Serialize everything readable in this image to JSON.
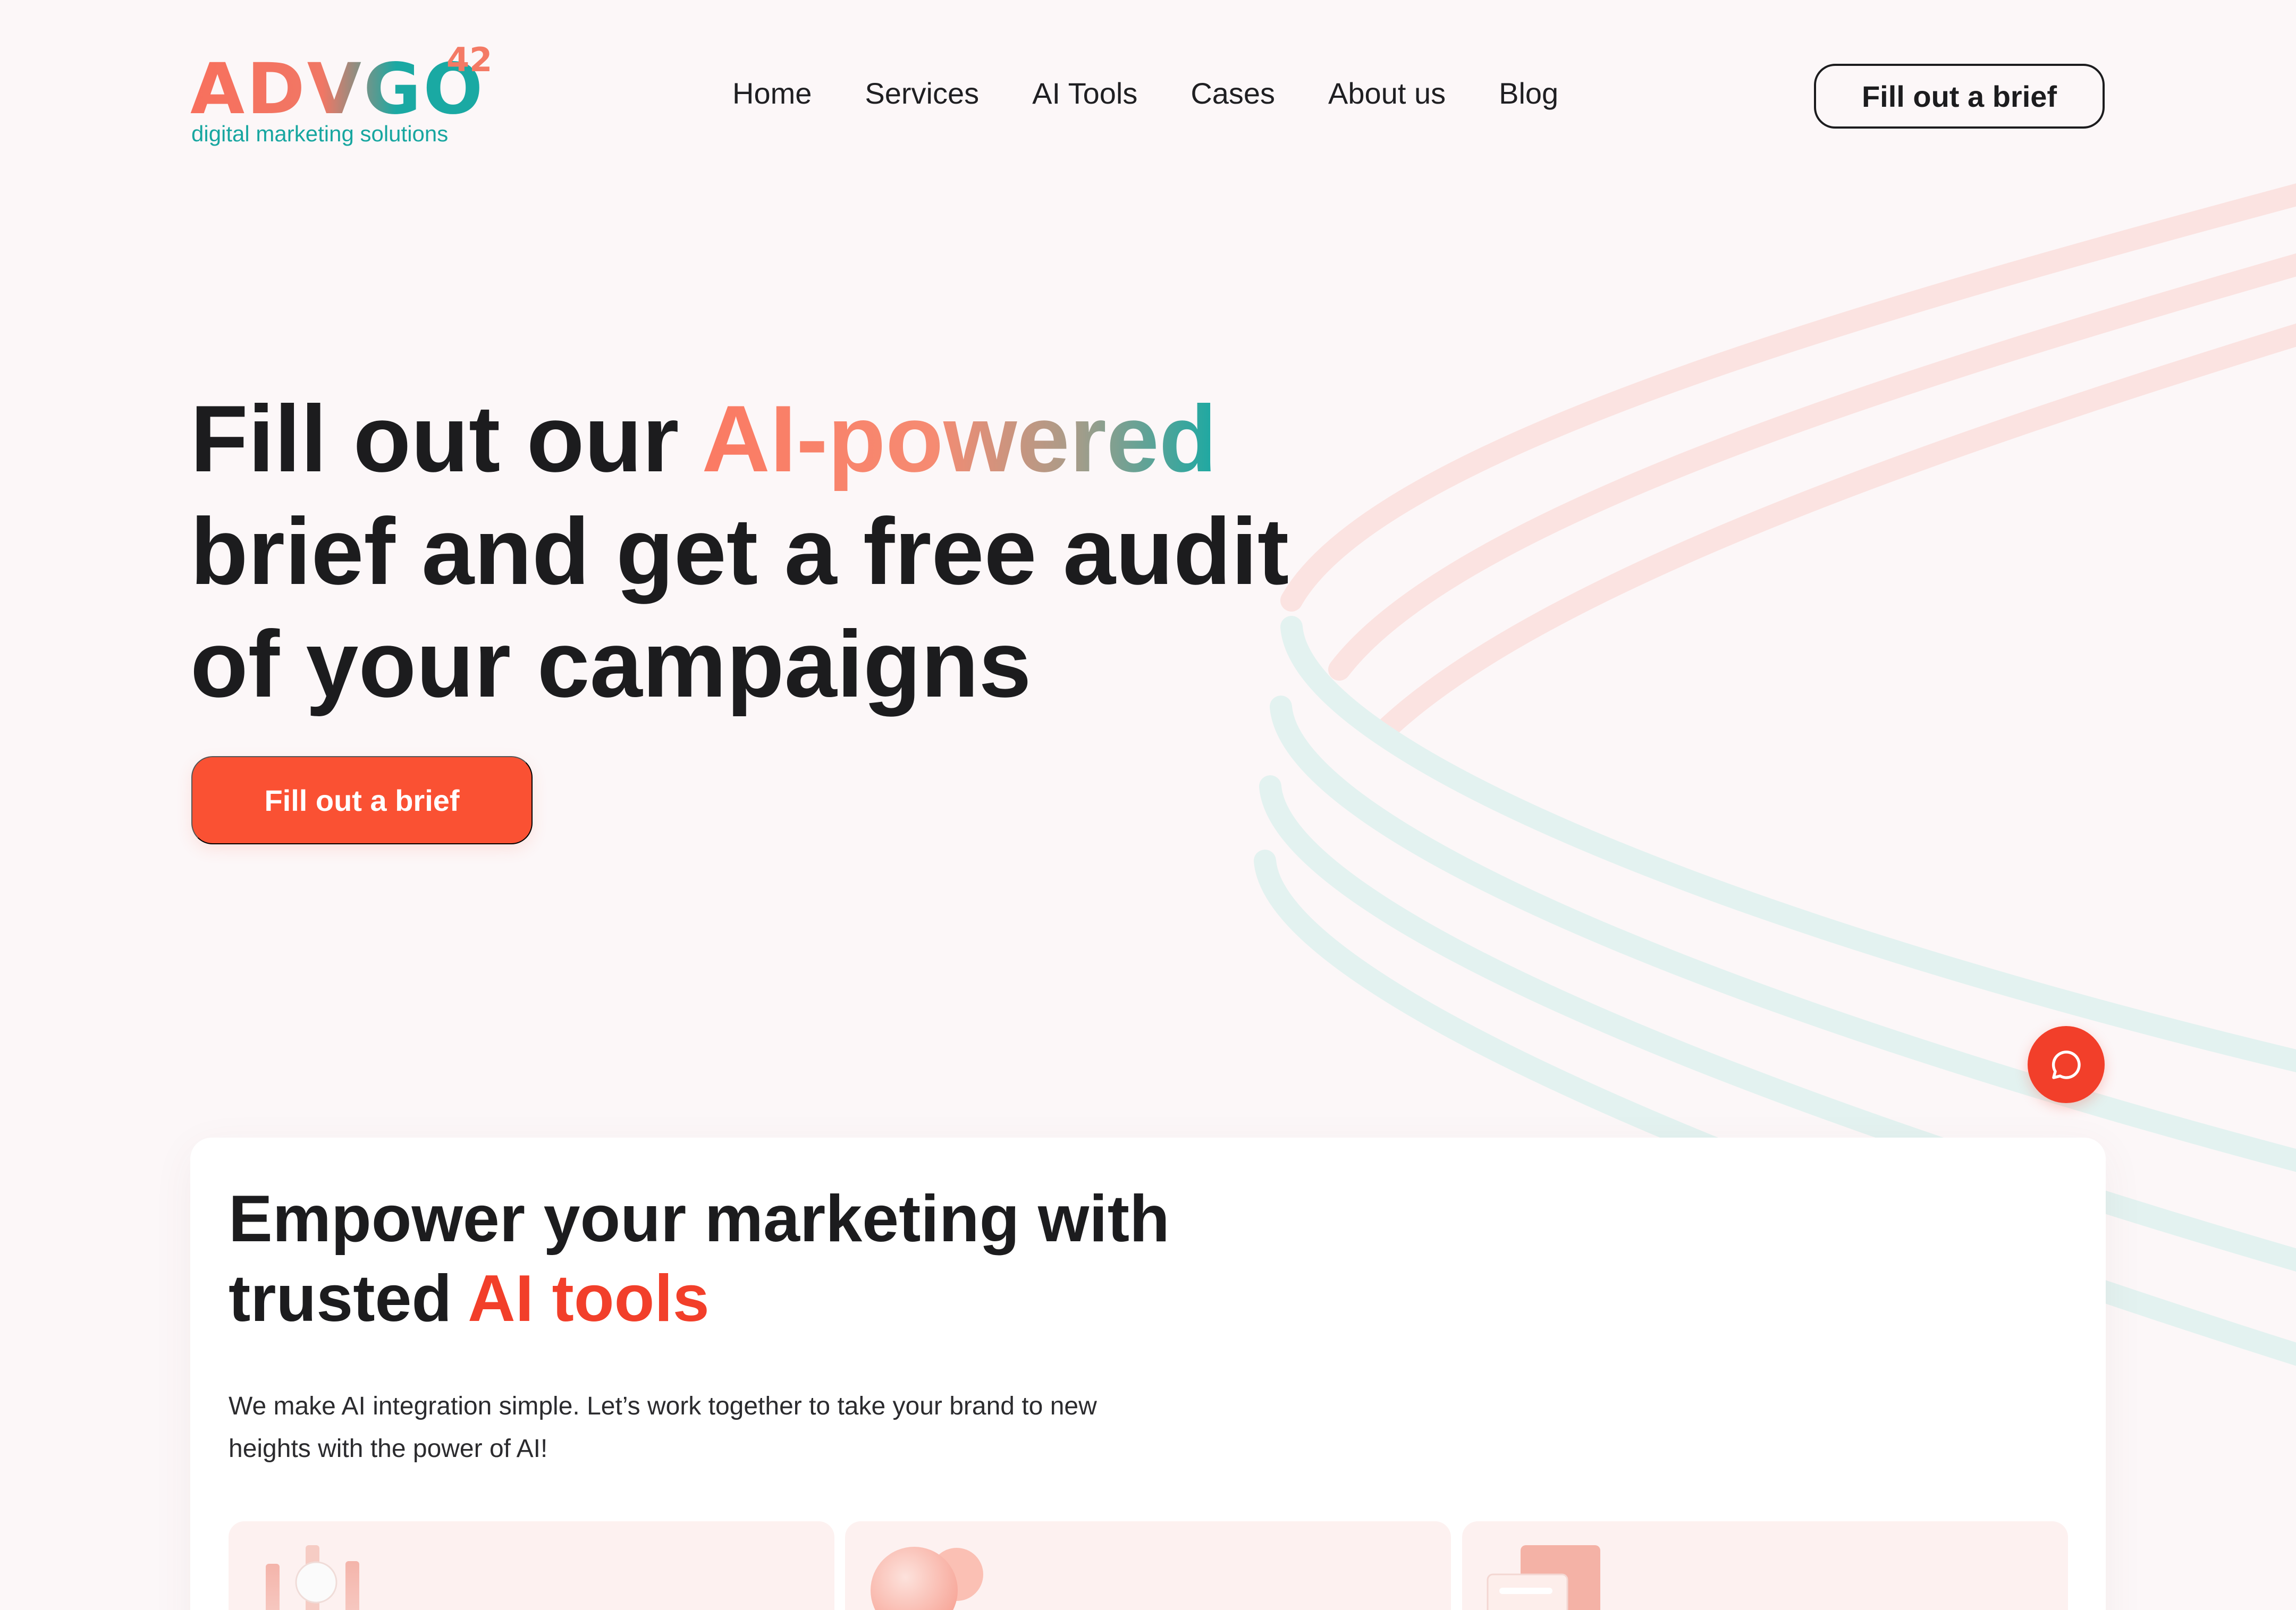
{
  "brand": {
    "name": "ADVGO",
    "superscript": "42",
    "tagline": "digital marketing solutions"
  },
  "nav": {
    "items": [
      {
        "label": "Home"
      },
      {
        "label": "Services"
      },
      {
        "label": "AI Tools"
      },
      {
        "label": "Cases"
      },
      {
        "label": "About us"
      },
      {
        "label": "Blog"
      }
    ],
    "cta_label": "Fill out a brief"
  },
  "hero": {
    "title_part1": "Fill out our ",
    "title_highlight": "AI-powered",
    "title_part2": " brief and get a free audit of your campaigns",
    "cta_label": "Fill out a brief"
  },
  "chat": {
    "icon": "chat-bubble-icon"
  },
  "section": {
    "title_part1": "Empower your marketing with trusted ",
    "title_highlight": "AI tools",
    "description": "We make AI integration simple. Let’s work together to take your brand to new heights with the power of AI!"
  },
  "colors": {
    "accent": "#fa5133",
    "accent_dark": "#f23f2a",
    "teal": "#1aa9a3",
    "coral": "#f8705d",
    "background": "#fcf7f8"
  }
}
